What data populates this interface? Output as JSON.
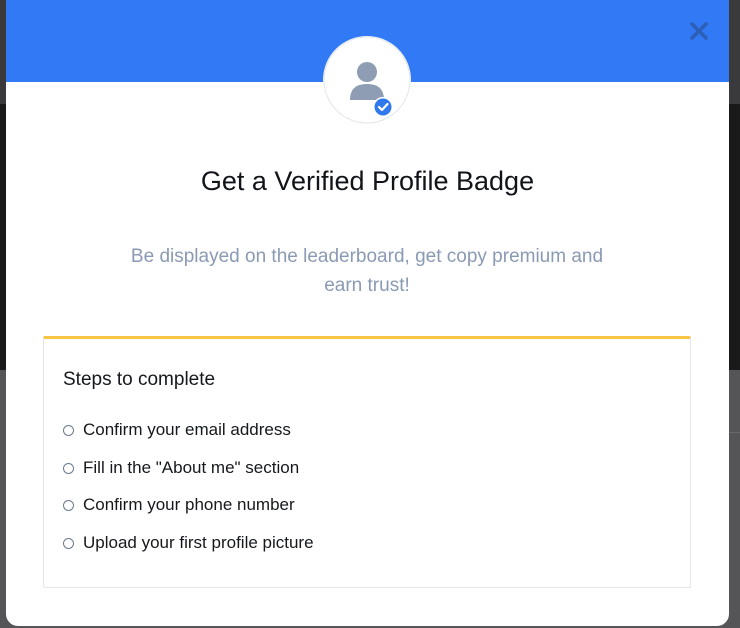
{
  "modal": {
    "title": "Get a Verified Profile Badge",
    "subtitle": "Be displayed on the leaderboard, get copy premium and earn trust!",
    "avatar_icon": "user-verified-icon",
    "close_icon": "close-icon"
  },
  "steps": {
    "heading": "Steps to complete",
    "items": [
      {
        "label": "Confirm your email address",
        "completed": false
      },
      {
        "label": "Fill in the \"About me\" section",
        "completed": false
      },
      {
        "label": "Confirm your phone number",
        "completed": false
      },
      {
        "label": "Upload your first profile picture",
        "completed": false
      }
    ]
  },
  "colors": {
    "header": "#3179f5",
    "accent_border": "#f7c443",
    "subtitle": "#8a9ab4",
    "badge": "#2f78ee"
  }
}
